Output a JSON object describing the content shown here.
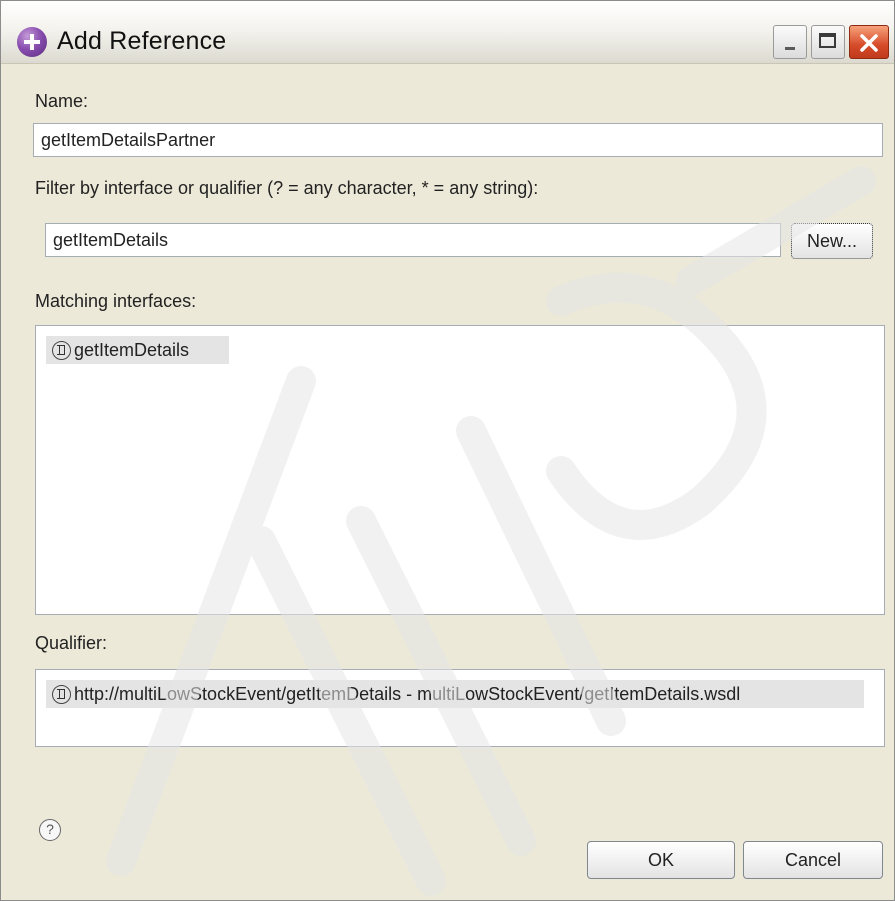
{
  "window": {
    "title": "Add Reference",
    "app_icon": "plus-reference-icon",
    "controls": [
      "minimize-icon",
      "maximize-icon",
      "close-icon"
    ]
  },
  "name_field": {
    "label": "Name:",
    "value": "getItemDetailsPartner"
  },
  "filter_field": {
    "label": "Filter by interface or qualifier (? = any character, * = any string):",
    "value": "getItemDetails",
    "new_button": "New..."
  },
  "matching_interfaces": {
    "label": "Matching interfaces:",
    "items": [
      "getItemDetails"
    ],
    "icon": "interface-icon"
  },
  "qualifier": {
    "label": "Qualifier:",
    "items": [
      "http://multiLowStockEvent/getItemDetails - multiLowStockEvent/getItemDetails.wsdl"
    ],
    "icon": "interface-icon"
  },
  "footer": {
    "help_icon": "?",
    "ok": "OK",
    "cancel": "Cancel"
  },
  "colors": {
    "selection": "#e4e4e4",
    "dialog_bg": "#ece9d8",
    "close_button": "#d64b2a"
  }
}
